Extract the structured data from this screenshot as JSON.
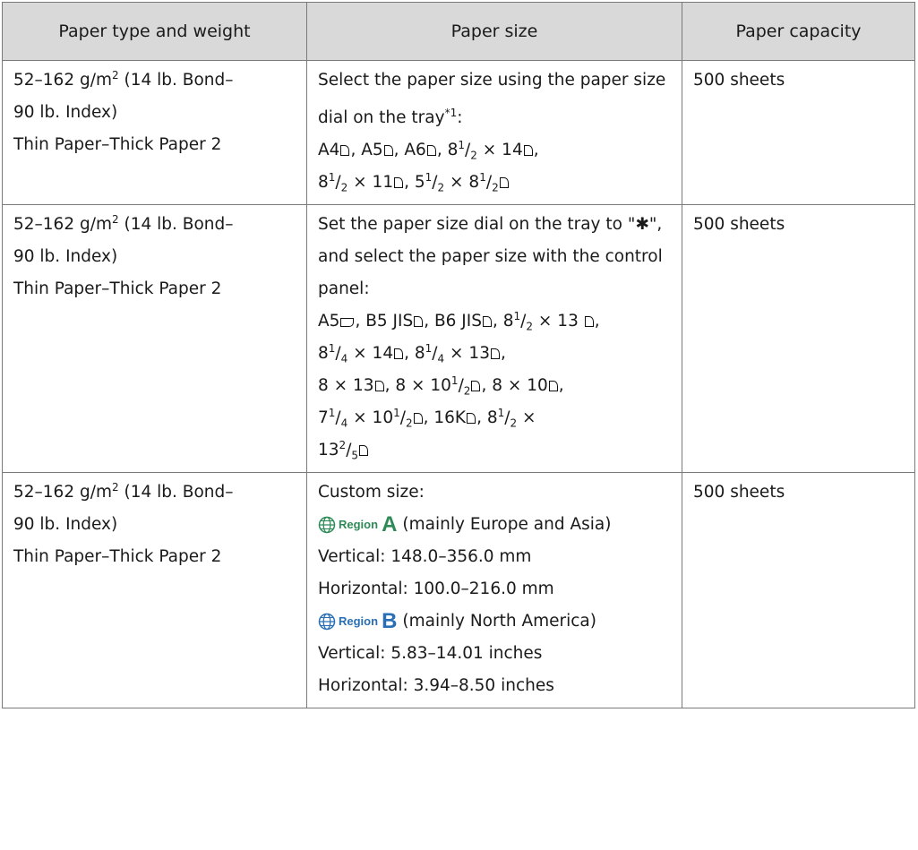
{
  "header": {
    "col1": "Paper type and weight",
    "col2": "Paper size",
    "col3": "Paper capacity"
  },
  "rows": [
    {
      "weight": {
        "a": "52–162 g/m",
        "b": "2",
        "c": " (14 lb. Bond–"
      },
      "weight2": "90 lb. Index)",
      "type": "Thin Paper–Thick Paper 2",
      "size_intro": "Select the paper size using the paper size dial on the tray",
      "footnote": "*1",
      "sizes": [
        "A4",
        "A5",
        "A6",
        "8",
        "1",
        "2",
        " × 14",
        "8",
        "1",
        "2",
        " × 11",
        "5",
        "1",
        "2",
        " × 8",
        "1",
        "2"
      ],
      "capacity": "500 sheets"
    },
    {
      "weight": {
        "a": "52–162 g/m",
        "b": "2",
        "c": " (14 lb. Bond–"
      },
      "weight2": "90 lb. Index)",
      "type": "Thin Paper–Thick Paper 2",
      "size_intro_a": "Set the paper size dial on the tray to",
      "size_intro_b": "\"✱\", and select the paper size with the control panel:",
      "capacity": "500 sheets"
    },
    {
      "weight": {
        "a": "52–162 g/m",
        "b": "2",
        "c": " (14 lb. Bond–"
      },
      "weight2": "90 lb. Index)",
      "type": "Thin Paper–Thick Paper 2",
      "custom_label": "Custom size:",
      "region_a": {
        "word": "Region",
        "letter": "A",
        "desc": "(mainly Europe and Asia)",
        "color": "#2e8b57"
      },
      "vertical_mm": "Vertical: 148.0–356.0 mm",
      "horizontal_mm": "Horizontal: 100.0–216.0 mm",
      "region_b": {
        "word": "Region",
        "letter": "B",
        "desc": "(mainly North America)",
        "color": "#2a6fb5"
      },
      "vertical_in": "Vertical: 5.83–14.01 inches",
      "horizontal_in": "Horizontal: 3.94–8.50 inches",
      "capacity": "500 sheets"
    }
  ],
  "icons": {
    "globe": "globe-icon",
    "portrait": "portrait-orientation-icon",
    "landscape": "landscape-orientation-icon"
  }
}
